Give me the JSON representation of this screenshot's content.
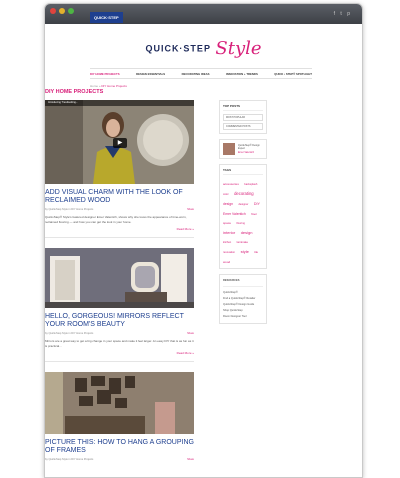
{
  "window": {
    "brand_tab": "QUICK·STEP"
  },
  "header": {
    "logo_main": "QUICK·STEP",
    "logo_script": "Style"
  },
  "nav": [
    {
      "label": "DIY HOME PROJECTS",
      "active": true
    },
    {
      "label": "DESIGN ESSENTIALS",
      "active": false
    },
    {
      "label": "DECORATING IDEAS",
      "active": false
    },
    {
      "label": "INNOVATION + TRENDS",
      "active": false
    },
    {
      "label": "QUICK • STEP® SPOTLIGHT",
      "active": false
    }
  ],
  "breadcrumb": {
    "home": "Home",
    "current": "DIY Home Projects"
  },
  "main": {
    "title": "DIY HOME PROJECTS",
    "posts": [
      {
        "video_label": "Introducing Trendsetting...",
        "title": "ADD VISUAL CHARM WITH THE LOOK OF RECLAIMED WOOD",
        "meta": "by Quick•Step Style in DIY Home Projects",
        "share": "Share",
        "excerpt": "Quick•Step® Style's featured designer Emer Valentich, shows why she loves the appearance of time-worn, reclaimed flooring — and how you can get the look in your home.",
        "readmore": "Read More »"
      },
      {
        "title": "HELLO, GORGEOUS! MIRRORS REFLECT YOUR ROOM'S BEAUTY",
        "meta": "by Quick•Step Style in DIY Home Projects",
        "share": "Share",
        "excerpt": "Mirrors are a great way to get a big change in your space and make it feel larger. An easy DIY that is as fun as it is practical...",
        "readmore": "Read More »"
      },
      {
        "title": "PICTURE THIS: HOW TO HANG A GROUPING OF FRAMES",
        "meta": "by Quick•Step Style in DIY Home Projects",
        "share": "Share"
      }
    ]
  },
  "sidebar": {
    "top_posts": {
      "title": "TOP POSTS",
      "tabs": [
        "MOST POPULAR",
        "COMMENTED POSTS"
      ]
    },
    "profile": {
      "line1": "Quick•Step® Design Expert",
      "line2": "Emer Valentich"
    },
    "tags": {
      "title": "TAGS",
      "items": [
        "accessories",
        "backsplash",
        "color",
        "decorating",
        "design",
        "designer",
        "DIY",
        "Emer Valentich",
        "floor space",
        "flooring",
        "interior",
        "design",
        "kitchen",
        "laminate",
        "renovation",
        "style",
        "tile",
        "wood"
      ]
    },
    "resources": {
      "title": "RESOURCES",
      "items": [
        "Quick•Step®",
        "Find a Quick•Step® Retailer",
        "Quick•Step® Design Guide",
        "Shop Quick•Step",
        "Room Designer Tool"
      ]
    }
  },
  "colors": {
    "accent": "#d8207a",
    "brand_blue": "#1e3f8f"
  }
}
